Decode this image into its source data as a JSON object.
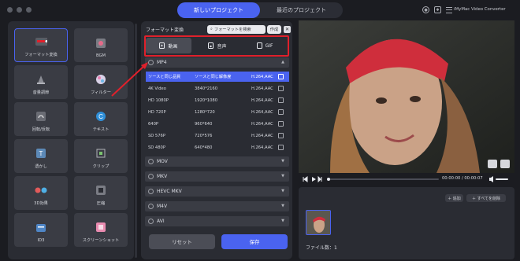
{
  "window": {
    "tabs": [
      {
        "label": "新しいプロジェクト",
        "active": true
      },
      {
        "label": "最近のプロジェクト",
        "active": false
      }
    ],
    "app_name": "iMyMac Video Converter",
    "accent": "#4a63f0"
  },
  "tools": [
    {
      "label": "フォーマット変換",
      "icon": "format-convert-icon",
      "active": true
    },
    {
      "label": "BGM",
      "icon": "music-icon"
    },
    {
      "label": "音量調節",
      "icon": "volume-icon"
    },
    {
      "label": "フィルター",
      "icon": "filter-icon"
    },
    {
      "label": "回転/反転",
      "icon": "rotate-icon"
    },
    {
      "label": "テキスト",
      "icon": "text-icon"
    },
    {
      "label": "透かし",
      "icon": "watermark-icon"
    },
    {
      "label": "クリップ",
      "icon": "clip-icon"
    },
    {
      "label": "3D効果",
      "icon": "3d-glasses-icon"
    },
    {
      "label": "圧縮",
      "icon": "compress-icon"
    },
    {
      "label": "ID3",
      "icon": "id3-icon"
    },
    {
      "label": "スクリーンショット",
      "icon": "screenshot-icon"
    }
  ],
  "format_panel": {
    "title": "フォーマット変換",
    "search_placeholder": "フォーマットを検索",
    "create_label": "作成",
    "segments": [
      {
        "label": "動画",
        "icon": "video-file-icon",
        "active": true
      },
      {
        "label": "音声",
        "icon": "audio-file-icon",
        "active": false
      },
      {
        "label": "GIF",
        "icon": "gif-file-icon",
        "active": false
      }
    ],
    "mp4_group": "MP4",
    "rows": [
      {
        "name": "ソースと同じ品質",
        "res": "ソースと同じ解像度",
        "codec": "H.264,AAC",
        "selected": true
      },
      {
        "name": "4K Video",
        "res": "3840*2160",
        "codec": "H.264,AAC"
      },
      {
        "name": "HD 1080P",
        "res": "1920*1080",
        "codec": "H.264,AAC"
      },
      {
        "name": "HD 720P",
        "res": "1280*720",
        "codec": "H.264,AAC"
      },
      {
        "name": "640P",
        "res": "960*640",
        "codec": "H.264,AAC"
      },
      {
        "name": "SD 576P",
        "res": "720*576",
        "codec": "H.264,AAC"
      },
      {
        "name": "SD 480P",
        "res": "640*480",
        "codec": "H.264,AAC"
      }
    ],
    "groups": [
      "MOV",
      "MKV",
      "HEVC MKV",
      "M4V",
      "AVI"
    ],
    "reset_label": "リセット",
    "save_label": "保存"
  },
  "player": {
    "time": "00:00:00 / 00:00:07"
  },
  "files": {
    "add_label": "＋ 追加",
    "delete_all_label": "＋ すべてを削除",
    "count_label": "ファイル数：1"
  }
}
